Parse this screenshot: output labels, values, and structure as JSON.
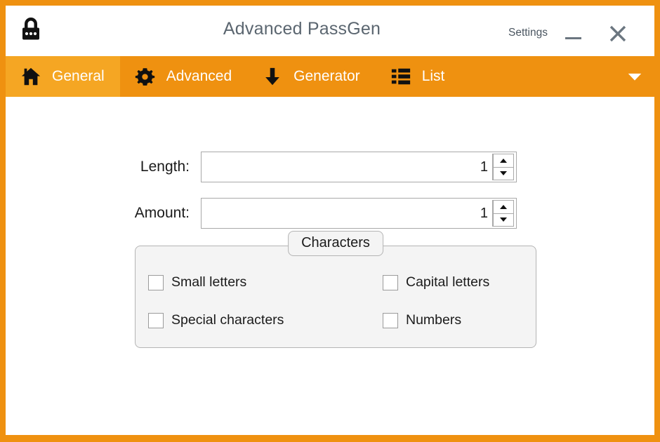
{
  "window": {
    "border_color": "#ef9110",
    "logo_icon": "padlock-icon",
    "title": "Advanced PassGen",
    "settings_label": "Settings",
    "minimize_icon": "minimize-icon",
    "close_icon": "close-icon"
  },
  "navbar": {
    "background_color": "#ef9110",
    "active_background_color": "#f5a623",
    "overflow_icon": "chevron-down-icon",
    "tabs": [
      {
        "label": "General",
        "icon": "home-icon",
        "active": true
      },
      {
        "label": "Advanced",
        "icon": "gear-icon",
        "active": false
      },
      {
        "label": "Generator",
        "icon": "down-arrow-icon",
        "active": false
      },
      {
        "label": "List",
        "icon": "list-icon",
        "active": false
      }
    ]
  },
  "form": {
    "length": {
      "label": "Length:",
      "value": "1"
    },
    "amount": {
      "label": "Amount:",
      "value": "1"
    }
  },
  "characters_group": {
    "legend": "Characters",
    "checkboxes": [
      {
        "label": "Small letters",
        "checked": false
      },
      {
        "label": "Capital letters",
        "checked": false
      },
      {
        "label": "Special characters",
        "checked": false
      },
      {
        "label": "Numbers",
        "checked": false
      }
    ]
  }
}
